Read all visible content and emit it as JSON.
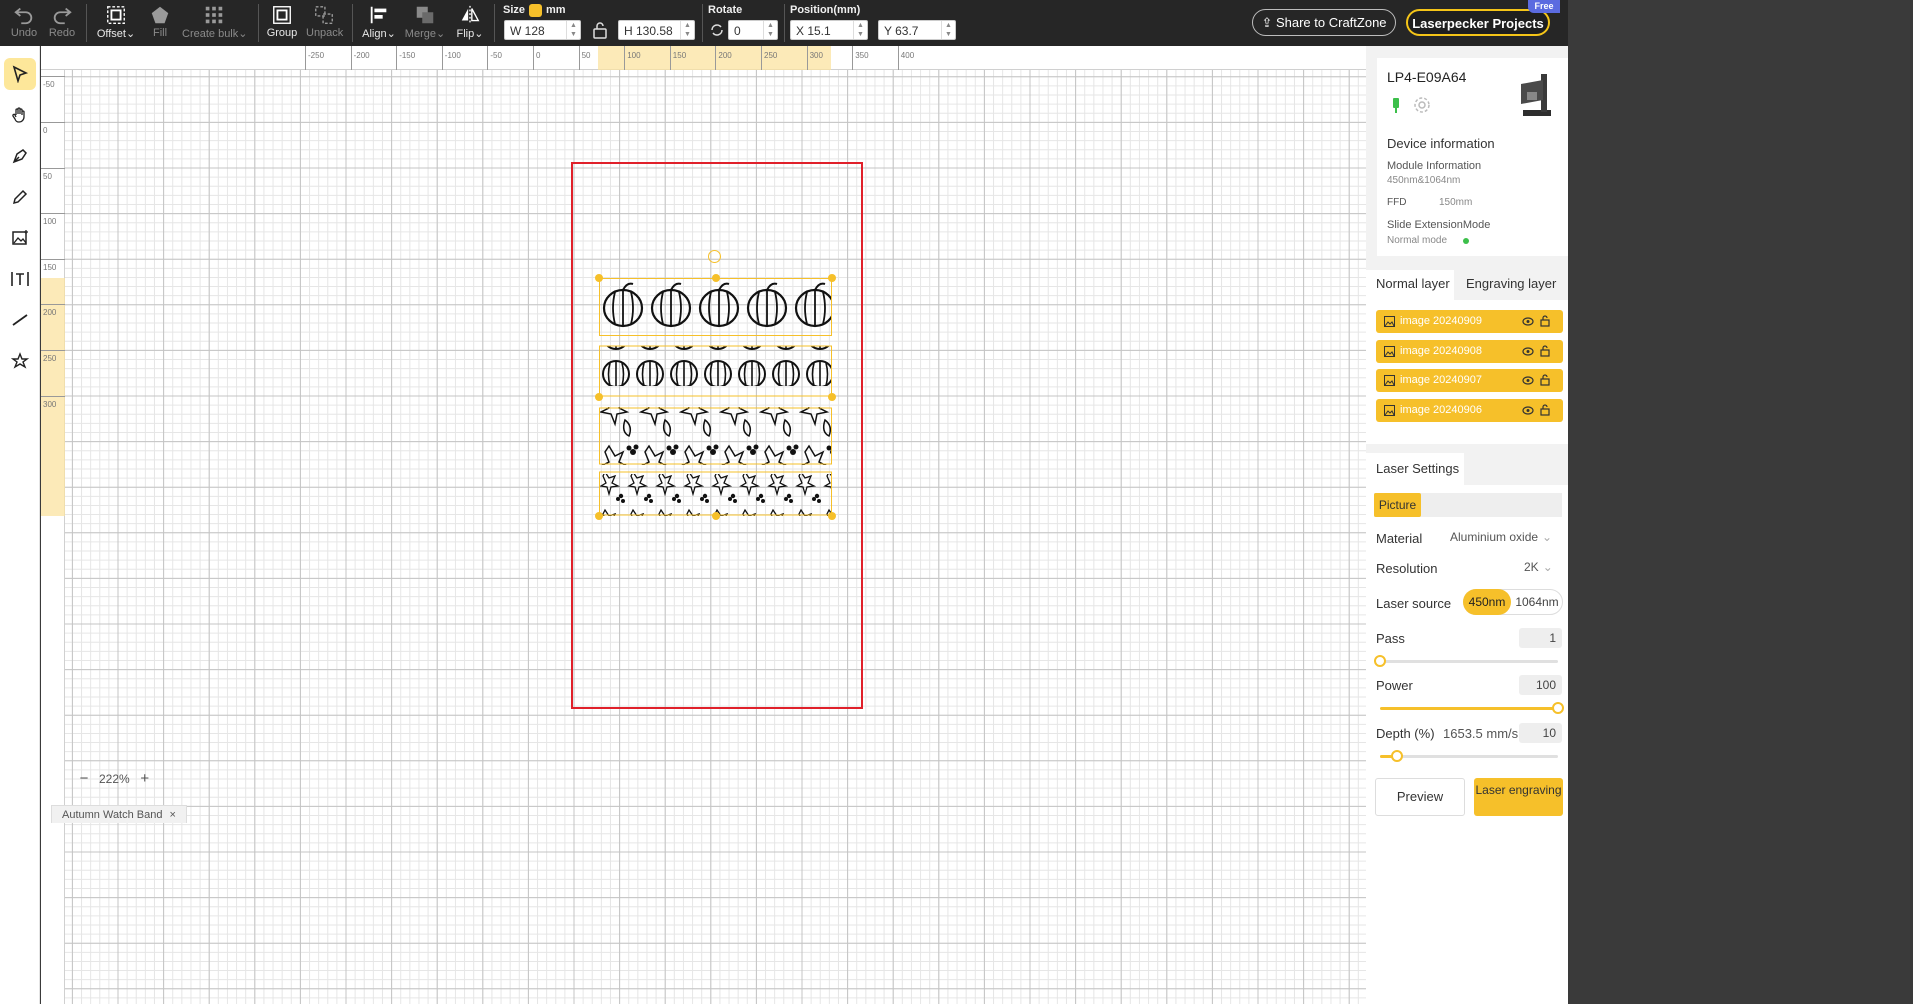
{
  "toolbar": {
    "undo": "Undo",
    "redo": "Redo",
    "offset": "Offset",
    "fill": "Fill",
    "create_bulk": "Create bulk",
    "group": "Group",
    "unpack": "Unpack",
    "align": "Align",
    "merge": "Merge",
    "flip": "Flip",
    "size_label": "Size",
    "unit": "mm",
    "width": "W 128",
    "height": "H 130.58",
    "rotate_label": "Rotate",
    "rotate": "0",
    "position_label": "Position(mm)",
    "x": "X 15.1",
    "y": "Y 63.7",
    "share": "Share to CraftZone",
    "projects": "Laserpecker Projects",
    "free_badge": "Free"
  },
  "ruler": {
    "top_ticks": [
      "-250",
      "-200",
      "-150",
      "-100",
      "-50",
      "0",
      "50",
      "100",
      "150",
      "200",
      "250",
      "300",
      "350",
      "400"
    ],
    "left_ticks": [
      "-50",
      "0",
      "50",
      "100",
      "150",
      "200",
      "250",
      "300"
    ]
  },
  "canvas": {
    "zoom": "222%",
    "document_tab": "Autumn Watch Band"
  },
  "device": {
    "name": "LP4-E09A64",
    "info_title": "Device information",
    "module_label": "Module Information",
    "module_value": "450nm&1064nm",
    "ffd_label": "FFD",
    "ffd_value": "150mm",
    "slide_label": "Slide ExtensionMode",
    "slide_value": "Normal mode"
  },
  "layers": {
    "tab_normal": "Normal layer",
    "tab_engraving": "Engraving layer",
    "items": [
      {
        "label": "image 20240909"
      },
      {
        "label": "image 20240908"
      },
      {
        "label": "image 20240907"
      },
      {
        "label": "image 20240906"
      }
    ]
  },
  "laser": {
    "title": "Laser Settings",
    "mode": "Picture",
    "material_label": "Material",
    "material_value": "Aluminium oxide",
    "resolution_label": "Resolution",
    "resolution_value": "2K",
    "source_label": "Laser source",
    "source_450": "450nm",
    "source_1064": "1064nm",
    "pass_label": "Pass",
    "pass_value": "1",
    "power_label": "Power",
    "power_value": "100",
    "depth_label": "Depth (%)",
    "speed_value": "1653.5 mm/s",
    "depth_value": "10",
    "preview": "Preview",
    "engrave": "Laser engraving"
  },
  "colors": {
    "accent": "#f6c02a",
    "boundary": "#e0202a",
    "toolbar": "#262626"
  }
}
